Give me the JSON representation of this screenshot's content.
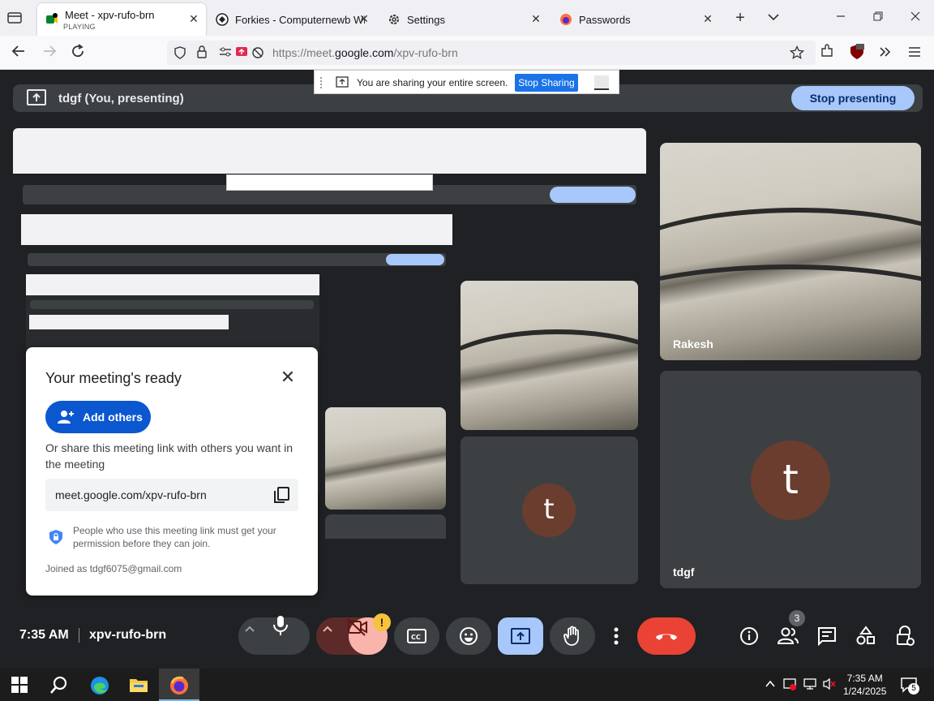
{
  "browser": {
    "tabs": [
      {
        "title": "Meet - xpv-rufo-brn",
        "subtitle": "PLAYING",
        "close": "✕"
      },
      {
        "title": "Forkies - Computernewb Wiki",
        "close": "✕"
      },
      {
        "title": "Settings",
        "close": "✕"
      },
      {
        "title": "Passwords",
        "close": "✕"
      }
    ],
    "new_tab": "+",
    "url_prefix": "https://meet.",
    "url_host": "google.com",
    "url_path": "/xpv-rufo-brn"
  },
  "share_banner": {
    "text": "You are sharing your entire screen.",
    "stop_label": "Stop Sharing"
  },
  "presenting": {
    "label": "tdgf (You, presenting)",
    "stop_label": "Stop presenting"
  },
  "participants": [
    {
      "name": "Rakesh"
    },
    {
      "name": "tdgf",
      "initial": "t"
    }
  ],
  "popup": {
    "title": "Your meeting's ready",
    "close": "✕",
    "add_label": "Add others",
    "share_text": "Or share this meeting link with others you want in the meeting",
    "link": "meet.google.com/xpv-rufo-brn",
    "permission_text": "People who use this meeting link must get your permission before they can join.",
    "joined": "Joined as tdgf6075@gmail.com"
  },
  "bottom": {
    "time": "7:35 AM",
    "code": "xpv-rufo-brn",
    "camera_warning": "!",
    "people_count": "3"
  },
  "taskbar": {
    "time": "7:35 AM",
    "date": "1/24/2025",
    "notifications": "5"
  },
  "colors": {
    "meet_bg": "#202124",
    "accent_blue": "#a8c7fa",
    "end_call_red": "#ea4335",
    "avatar_brown": "#6b3d2f"
  }
}
